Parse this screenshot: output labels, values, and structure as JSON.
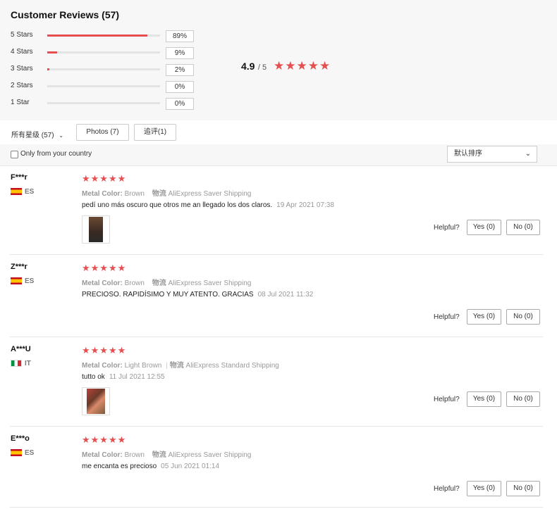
{
  "header": {
    "title": "Customer Reviews (57)"
  },
  "distribution": [
    {
      "label": "5 Stars",
      "percent": "89%",
      "fraction": 0.89
    },
    {
      "label": "4 Stars",
      "percent": "9%",
      "fraction": 0.09
    },
    {
      "label": "3 Stars",
      "percent": "2%",
      "fraction": 0.02
    },
    {
      "label": "2 Stars",
      "percent": "0%",
      "fraction": 0.0
    },
    {
      "label": "1 Star",
      "percent": "0%",
      "fraction": 0.0
    }
  ],
  "overall": {
    "score": "4.9",
    "out_of": "/ 5",
    "stars": "★★★★★"
  },
  "filters": {
    "all": "所有星级 (57)",
    "photos": "Photos (7)",
    "additional": "追评(1)"
  },
  "country_filter": {
    "label": "Only from your country"
  },
  "sort": {
    "value": "默认排序"
  },
  "icons": {
    "star": "star-icon",
    "chevron": "chevron-down-icon",
    "checkbox": "checkbox-icon"
  },
  "colors": {
    "accent": "#e64f4f"
  },
  "reviews": [
    {
      "name": "F***r",
      "country": "ES",
      "stars": "★★★★★",
      "color_label": "Metal Color:",
      "color_value": "Brown",
      "shipping_label": "物流",
      "shipping_value": "AliExpress Saver Shipping",
      "text": "pedí uno más oscuro que otros me an llegado los dos claros.",
      "date": "19 Apr 2021 07:38",
      "helpful": "Helpful?",
      "yes": "Yes (0)",
      "no": "No (0)"
    },
    {
      "name": "Z***r",
      "country": "ES",
      "stars": "★★★★★",
      "color_label": "Metal Color:",
      "color_value": "Brown",
      "shipping_label": "物流",
      "shipping_value": "AliExpress Saver Shipping",
      "text": "PRECIOSO. RAPIDÍSIMO Y MUY ATENTO. GRACIAS",
      "date": "08 Jul 2021 11:32",
      "helpful": "Helpful?",
      "yes": "Yes (0)",
      "no": "No (0)"
    },
    {
      "name": "A***U",
      "country": "IT",
      "stars": "★★★★★",
      "color_label": "Metal Color:",
      "color_value": "Light Brown",
      "shipping_label": "物流",
      "shipping_value": "AliExpress Standard Shipping",
      "text": "tutto ok",
      "date": "11 Jul 2021 12:55",
      "helpful": "Helpful?",
      "yes": "Yes (0)",
      "no": "No (0)"
    },
    {
      "name": "E***o",
      "country": "ES",
      "stars": "★★★★★",
      "color_label": "Metal Color:",
      "color_value": "Brown",
      "shipping_label": "物流",
      "shipping_value": "AliExpress Saver Shipping",
      "text": "me encanta es precioso",
      "date": "05 Jun 2021 01:14",
      "helpful": "Helpful?",
      "yes": "Yes (0)",
      "no": "No (0)"
    }
  ]
}
